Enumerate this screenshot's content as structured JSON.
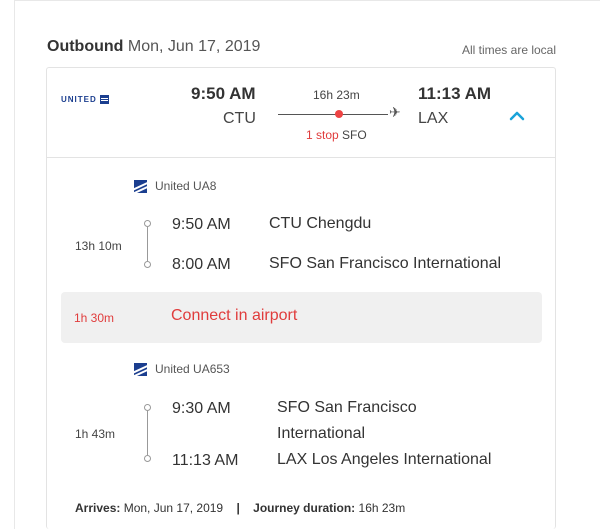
{
  "header": {
    "direction": "Outbound",
    "date": "Mon, Jun 17, 2019",
    "note": "All times are local"
  },
  "summary": {
    "airline_logo_text": "UNITED",
    "depart_time": "9:50 AM",
    "depart_code": "CTU",
    "arrive_time": "11:13 AM",
    "arrive_code": "LAX",
    "duration": "16h 23m",
    "stops_label": "1 stop",
    "stop_code": "SFO"
  },
  "segments": [
    {
      "airline": "United UA8",
      "duration": "13h 10m",
      "depart_time": "9:50 AM",
      "depart_place": "CTU Chengdu",
      "arrive_time": "8:00 AM",
      "arrive_place": "SFO San Francisco International"
    },
    {
      "airline": "United UA653",
      "duration": "1h 43m",
      "depart_time": "9:30 AM",
      "depart_place": "SFO San Francisco International",
      "arrive_time": "11:13 AM",
      "arrive_place": "LAX Los Angeles International"
    }
  ],
  "connection": {
    "duration": "1h 30m",
    "message": "Connect in airport"
  },
  "footer": {
    "arrives_label": "Arrives:",
    "arrives_value": "Mon, Jun 17, 2019",
    "separator": "|",
    "journey_label": "Journey duration:",
    "journey_value": "16h 23m"
  },
  "colors": {
    "alert": "#e03c3c",
    "accent": "#1aa3d9",
    "brand": "#1b3e8f"
  },
  "icons": {
    "plane": "plane-icon",
    "collapse": "chevron-up-icon",
    "airline": "united-globe-icon"
  }
}
